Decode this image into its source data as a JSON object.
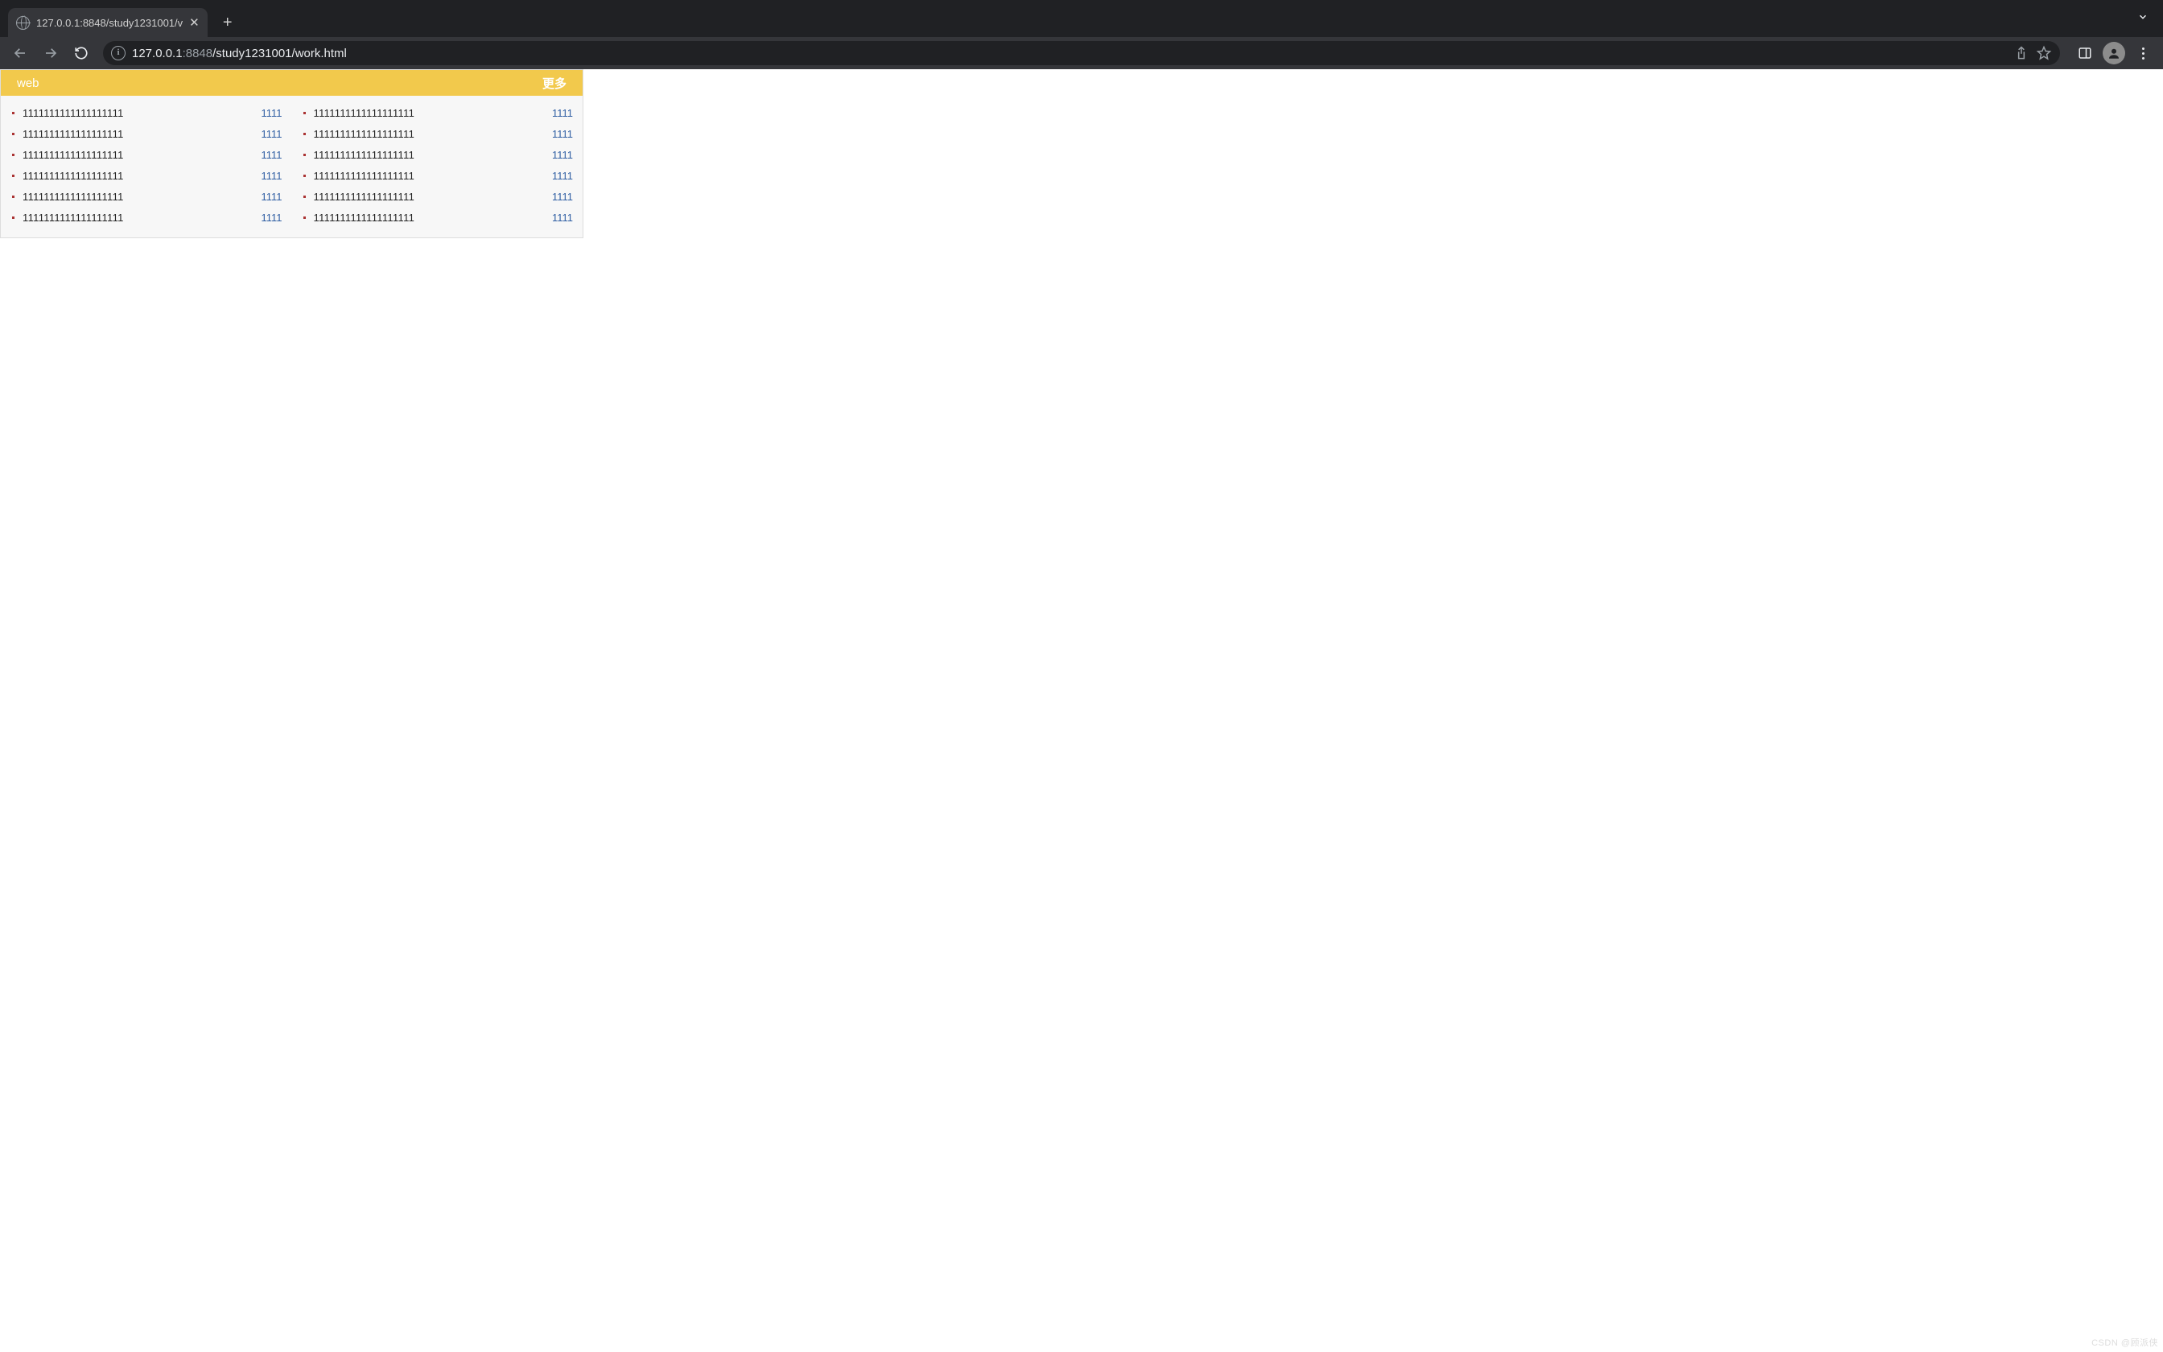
{
  "browser": {
    "tab_title": "127.0.0.1:8848/study1231001/v",
    "url_host_strong": "127.0.0.1",
    "url_rest_dim1": ":8848",
    "url_rest_strong": "/study1231001/work.html",
    "newtab_glyph": "+",
    "close_glyph": "✕"
  },
  "widget": {
    "title": "web",
    "more": "更多",
    "left": [
      {
        "text": "1111111111111111111",
        "right": "1111"
      },
      {
        "text": "1111111111111111111",
        "right": "1111"
      },
      {
        "text": "1111111111111111111",
        "right": "1111"
      },
      {
        "text": "1111111111111111111",
        "right": "1111"
      },
      {
        "text": "1111111111111111111",
        "right": "1111"
      },
      {
        "text": "1111111111111111111",
        "right": "1111"
      }
    ],
    "right": [
      {
        "text": "1111111111111111111",
        "right": "1111"
      },
      {
        "text": "1111111111111111111",
        "right": "1111"
      },
      {
        "text": "1111111111111111111",
        "right": "1111"
      },
      {
        "text": "1111111111111111111",
        "right": "1111"
      },
      {
        "text": "1111111111111111111",
        "right": "1111"
      },
      {
        "text": "1111111111111111111",
        "right": "1111"
      }
    ]
  },
  "watermark": "CSDN @顾派侠"
}
